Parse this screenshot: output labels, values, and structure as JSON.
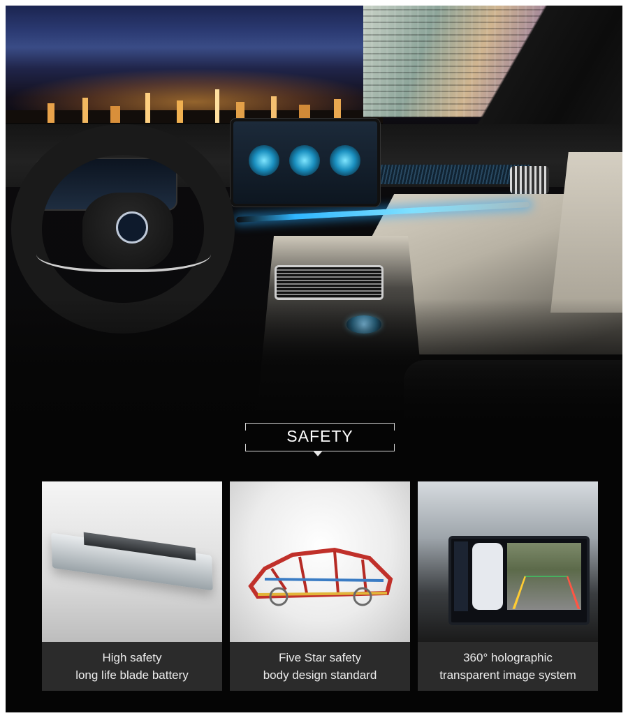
{
  "section": {
    "heading": "SAFETY"
  },
  "features": [
    {
      "line1": "High safety",
      "line2": "long life blade battery",
      "icon": "blade-battery-image"
    },
    {
      "line1": "Five Star safety",
      "line2": "body design standard",
      "icon": "car-body-frame-image"
    },
    {
      "line1": "360° holographic",
      "line2": "transparent image system",
      "icon": "360-camera-screen-image"
    }
  ],
  "colors": {
    "background": "#050505",
    "caption_bar": "#2b2b2b",
    "caption_text": "#ececec",
    "ambient_light": "#2fb6ff"
  }
}
